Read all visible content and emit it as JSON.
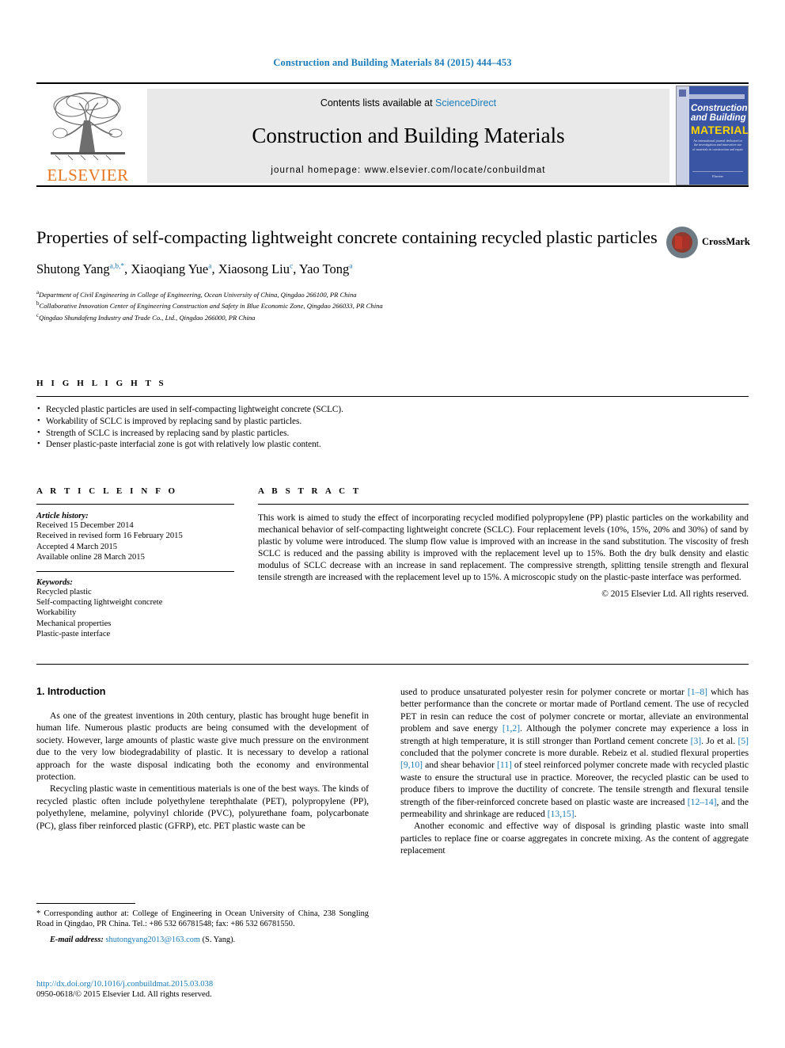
{
  "running_head": "Construction and Building Materials 84 (2015) 444–453",
  "masthead": {
    "publisher_name": "ELSEVIER",
    "contents_prefix": "Contents lists available at ",
    "contents_link": "ScienceDirect",
    "journal_title": "Construction and Building Materials",
    "homepage": "journal homepage: www.elsevier.com/locate/conbuildmat",
    "cover": {
      "line1": "Construction",
      "line2": "and Building",
      "line3": "MATERIALS",
      "blurb": "An international journal dedicated to the investigation and innovative use of materials in construction and repair",
      "footer": "Elsevier"
    }
  },
  "article": {
    "title": "Properties of self-compacting lightweight concrete containing recycled plastic particles",
    "authors": [
      {
        "name": "Shutong Yang",
        "sup": "a,b,*"
      },
      {
        "name": "Xiaoqiang Yue",
        "sup": "a"
      },
      {
        "name": "Xiaosong Liu",
        "sup": "c"
      },
      {
        "name": "Yao Tong",
        "sup": "a"
      }
    ],
    "affiliations": [
      {
        "marker": "a",
        "text": "Department of Civil Engineering in College of Engineering, Ocean University of China, Qingdao 266100, PR China"
      },
      {
        "marker": "b",
        "text": "Collaborative Innovation Center of Engineering Construction and Safety in Blue Economic Zone, Qingdao 266033, PR China"
      },
      {
        "marker": "c",
        "text": "Qingdao Shundafeng Industry and Trade Co., Ltd., Qingdao 266000, PR China"
      }
    ],
    "crossmark_label": "CrossMark"
  },
  "highlights": {
    "label": "H I G H L I G H T S",
    "items": [
      "Recycled plastic particles are used in self-compacting lightweight concrete (SCLC).",
      "Workability of SCLC is improved by replacing sand by plastic particles.",
      "Strength of SCLC is increased by replacing sand by plastic particles.",
      "Denser plastic-paste interfacial zone is got with relatively low plastic content."
    ]
  },
  "article_info": {
    "label": "A R T I C L E   I N F O",
    "history_heading": "Article history:",
    "history": [
      "Received 15 December 2014",
      "Received in revised form 16 February 2015",
      "Accepted 4 March 2015",
      "Available online 28 March 2015"
    ],
    "keywords_heading": "Keywords:",
    "keywords": [
      "Recycled plastic",
      "Self-compacting lightweight concrete",
      "Workability",
      "Mechanical properties",
      "Plastic-paste interface"
    ]
  },
  "abstract": {
    "label": "A B S T R A C T",
    "text": "This work is aimed to study the effect of incorporating recycled modified polypropylene (PP) plastic particles on the workability and mechanical behavior of self-compacting lightweight concrete (SCLC). Four replacement levels (10%, 15%, 20% and 30%) of sand by plastic by volume were introduced. The slump flow value is improved with an increase in the sand substitution. The viscosity of fresh SCLC is reduced and the passing ability is improved with the replacement level up to 15%. Both the dry bulk density and elastic modulus of SCLC decrease with an increase in sand replacement. The compressive strength, splitting tensile strength and flexural tensile strength are increased with the replacement level up to 15%. A microscopic study on the plastic-paste interface was performed.",
    "copyright": "© 2015 Elsevier Ltd. All rights reserved."
  },
  "body": {
    "section_title": "1. Introduction",
    "left_paragraphs": [
      "As one of the greatest inventions in 20th century, plastic has brought huge benefit in human life. Numerous plastic products are being consumed with the development of society. However, large amounts of plastic waste give much pressure on the environment due to the very low biodegradability of plastic. It is necessary to develop a rational approach for the waste disposal indicating both the economy and environmental protection.",
      "Recycling plastic waste in cementitious materials is one of the best ways. The kinds of recycled plastic often include polyethylene terephthalate (PET), polypropylene (PP), polyethylene, melamine, polyvinyl chloride (PVC), polyurethane foam, polycarbonate (PC), glass fiber reinforced plastic (GFRP), etc. PET plastic waste can be"
    ],
    "right_paragraph_1_parts": [
      {
        "t": "used to produce unsaturated polyester resin for polymer concrete or mortar ",
        "k": "text"
      },
      {
        "t": "[1–8]",
        "k": "ref"
      },
      {
        "t": " which has better performance than the concrete or mortar made of Portland cement. The use of recycled PET in resin can reduce the cost of polymer concrete or mortar, alleviate an environmental problem and save energy ",
        "k": "text"
      },
      {
        "t": "[1,2]",
        "k": "ref"
      },
      {
        "t": ". Although the polymer concrete may experience a loss in strength at high temperature, it is still stronger than Portland cement concrete ",
        "k": "text"
      },
      {
        "t": "[3]",
        "k": "ref"
      },
      {
        "t": ". Jo et al. ",
        "k": "text"
      },
      {
        "t": "[5]",
        "k": "ref"
      },
      {
        "t": " concluded that the polymer concrete is more durable. Rebeiz et al. studied flexural properties ",
        "k": "text"
      },
      {
        "t": "[9,10]",
        "k": "ref"
      },
      {
        "t": " and shear behavior ",
        "k": "text"
      },
      {
        "t": "[11]",
        "k": "ref"
      },
      {
        "t": " of steel reinforced polymer concrete made with recycled plastic waste to ensure the structural use in practice. Moreover, the recycled plastic can be used to produce fibers to improve the ductility of concrete. The tensile strength and flexural tensile strength of the fiber-reinforced concrete based on plastic waste are increased ",
        "k": "text"
      },
      {
        "t": "[12–14]",
        "k": "ref"
      },
      {
        "t": ", and the permeability and shrinkage are reduced ",
        "k": "text"
      },
      {
        "t": "[13,15]",
        "k": "ref"
      },
      {
        "t": ".",
        "k": "text"
      }
    ],
    "right_paragraph_2": "Another economic and effective way of disposal is grinding plastic waste into small particles to replace fine or coarse aggregates in concrete mixing. As the content of aggregate replacement"
  },
  "footnotes": {
    "corresponding": "* Corresponding author at: College of Engineering in Ocean University of China, 238 Songling Road in Qingdao, PR China. Tel.: +86 532 66781548; fax: +86 532 66781550.",
    "email_label": "E-mail address:",
    "email": "shutongyang2013@163.com",
    "email_suffix": " (S. Yang).",
    "doi": "http://dx.doi.org/10.1016/j.conbuildmat.2015.03.038",
    "issn": "0950-0618/© 2015 Elsevier Ltd. All rights reserved."
  },
  "colors": {
    "link": "#1a7bb9",
    "elsevier_orange": "#e87722",
    "cover_blue": "#3a55a4",
    "cover_yellow": "#ffd400"
  }
}
